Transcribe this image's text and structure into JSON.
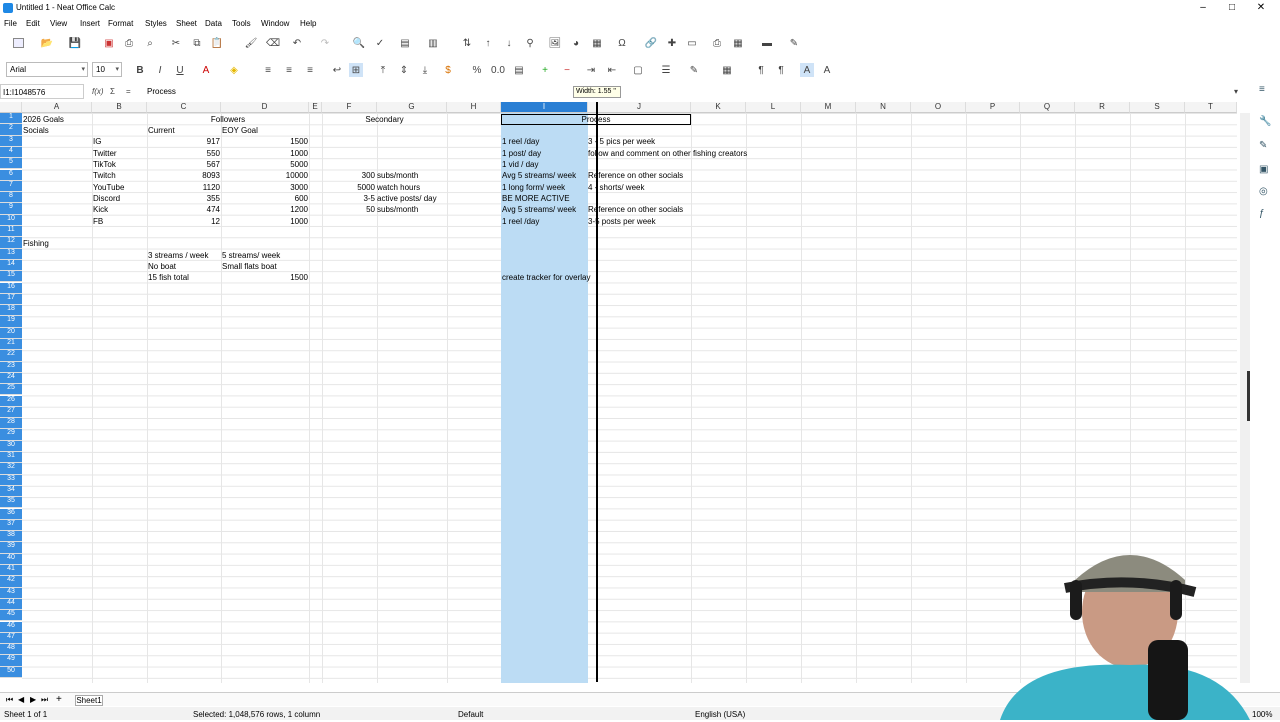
{
  "window": {
    "title": "Untitled 1 - Neat Office Calc"
  },
  "menu": [
    "File",
    "Edit",
    "View",
    "Insert",
    "Format",
    "Styles",
    "Sheet",
    "Data",
    "Tools",
    "Window",
    "Help"
  ],
  "font": {
    "name": "Arial",
    "size": "10"
  },
  "namebox": "I1:I1048576",
  "formula": "Process",
  "width_tip": "Width: 1.55 \"",
  "columns": [
    "A",
    "B",
    "C",
    "D",
    "E",
    "F",
    "G",
    "H",
    "I",
    "J",
    "K",
    "L",
    "M",
    "N",
    "O",
    "P",
    "Q",
    "R",
    "S",
    "T"
  ],
  "rows": [
    "1",
    "2",
    "3",
    "4",
    "5",
    "6",
    "7",
    "8",
    "9",
    "10",
    "11",
    "12",
    "13",
    "14",
    "15",
    "16",
    "17",
    "18",
    "19",
    "20",
    "21",
    "22",
    "23",
    "24",
    "25",
    "26",
    "27",
    "28",
    "29",
    "30",
    "31",
    "32",
    "33",
    "34",
    "35",
    "36",
    "37",
    "38",
    "39",
    "40",
    "41",
    "42",
    "43",
    "44",
    "45",
    "46",
    "47",
    "48",
    "49",
    "50"
  ],
  "cells": {
    "a1": "2026 Goals",
    "c1": "Followers",
    "f1": "Secondary",
    "i1": "Process",
    "a2": "Socials",
    "c2": "Current",
    "d2": "EOY Goal",
    "b3": "IG",
    "c3": "917",
    "d3": "1500",
    "i3": "1 reel /day",
    "j3": "3 - 5 pics per week",
    "b4": "Twitter",
    "c4": "550",
    "d4": "1000",
    "i4": "1 post/ day",
    "j4": "follow and comment on other fishing creators",
    "b5": "TikTok",
    "c5": "567",
    "d5": "5000",
    "i5": "1 vid / day",
    "b6": "Twitch",
    "c6": "8093",
    "d6": "10000",
    "f6": "300",
    "g6": "subs/month",
    "i6": "Avg 5 streams/ week",
    "j6": "Reference on other socials",
    "b7": "YouTube",
    "c7": "1120",
    "d7": "3000",
    "f7": "5000",
    "g7": "watch hours",
    "i7": "1 long form/ week",
    "j7": "4 - shorts/ week",
    "b8": "Discord",
    "c8": "355",
    "d8": "600",
    "f8": "3-5",
    "g8": "active posts/ day",
    "i8": "BE MORE ACTIVE",
    "b9": "Kick",
    "c9": "474",
    "d9": "1200",
    "f9": "50",
    "g9": "subs/month",
    "i9": "Avg 5 streams/ week",
    "j9": "Reference on other socials",
    "b10": "FB",
    "c10": "12",
    "d10": "1000",
    "i10": "1 reel /day",
    "j10": "3-5 posts per week",
    "a12": "Fishing",
    "c13": "3 streams / week",
    "d13": "5 streams/ week",
    "c14": "No boat",
    "d14": "Small flats boat",
    "c15": "15 fish total",
    "d15": "1500",
    "i15": "create tracker for overlay"
  },
  "sheet_tab": "Sheet1",
  "status": {
    "sheet": "Sheet 1 of 1",
    "selection": "Selected: 1,048,576 rows, 1 column",
    "style": "Default",
    "lang": "English (USA)",
    "zoom": "100%"
  },
  "colors": {
    "selection": "#bcdcf4",
    "header_selected": "#2a7fd4"
  }
}
